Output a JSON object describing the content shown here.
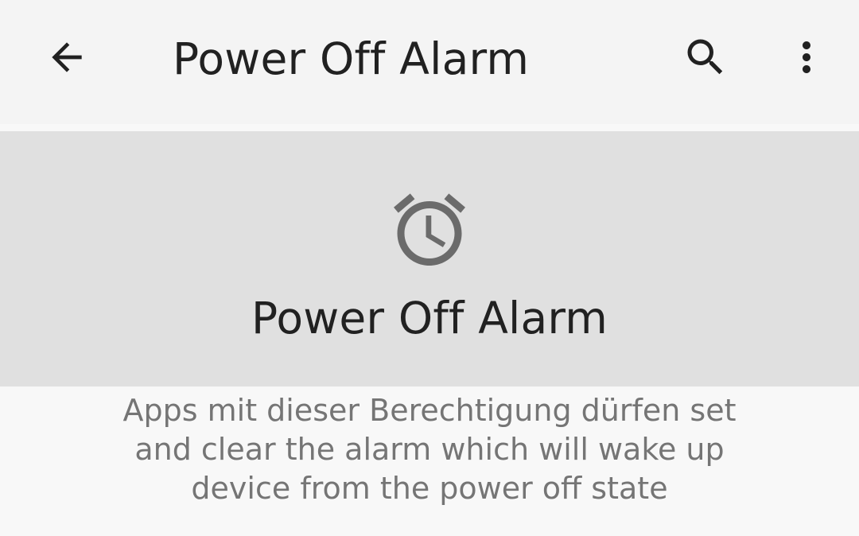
{
  "app_bar": {
    "title": "Power Off Alarm",
    "back_icon": "arrow-back-icon",
    "search_icon": "search-icon",
    "more_icon": "more-vert-icon"
  },
  "hero": {
    "icon": "alarm-clock-icon",
    "title": "Power Off Alarm"
  },
  "description": {
    "text": "Apps mit dieser Berechtigung dürfen set and clear the alarm which will wake up device from the power off state"
  },
  "colors": {
    "app_bar_bg": "#f4f4f4",
    "hero_bg": "#e0e0e0",
    "page_bg": "#f8f8f8",
    "title_text": "#212121",
    "description_text": "#757575",
    "hero_icon": "#6b6b6b"
  }
}
